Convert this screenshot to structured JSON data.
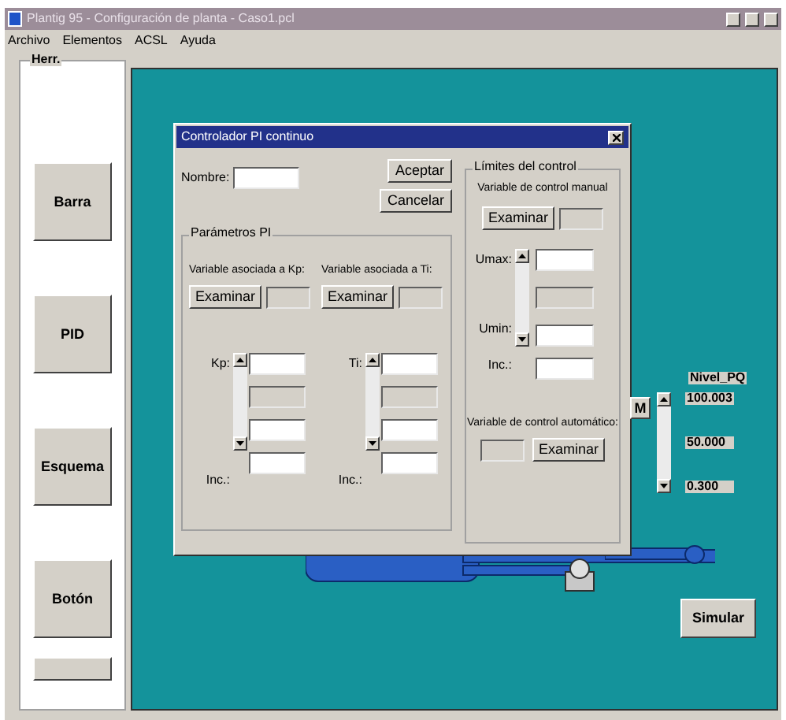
{
  "window": {
    "title": "Plantig 95 - Configuración de planta - Caso1.pcl"
  },
  "menu": [
    "Archivo",
    "Elementos",
    "ACSL",
    "Ayuda"
  ],
  "sidebar": {
    "title": "Herr.",
    "buttons": [
      "Barra",
      "PID",
      "Esquema",
      "Botón"
    ]
  },
  "canvas": {
    "level_label": "Nivel_PQ",
    "manual_button": "M",
    "readings": [
      "100.003",
      "50.000",
      "0.300"
    ],
    "simulate_button": "Simular"
  },
  "dialog": {
    "title": "Controlador PI continuo",
    "name_label": "Nombre:",
    "buttons": [
      "Aceptar",
      "Cancelar"
    ],
    "pi_group": {
      "title": "Parámetros PI",
      "columns": [
        {
          "variable_label": "Variable asociada a Kp:",
          "browse": "Examinar",
          "param_label": "Kp:",
          "inc_label": "Inc.:"
        },
        {
          "variable_label": "Variable asociada a Ti:",
          "browse": "Examinar",
          "param_label": "Ti:",
          "inc_label": "Inc.:"
        }
      ]
    },
    "limits_group": {
      "title": "Límites del control",
      "manual_label": "Variable de control manual",
      "browse": "Examinar",
      "umax_label": "Umax:",
      "umin_label": "Umin:",
      "inc_label": "Inc.:",
      "auto_label": "Variable de control automático:",
      "auto_browse": "Examinar"
    }
  }
}
